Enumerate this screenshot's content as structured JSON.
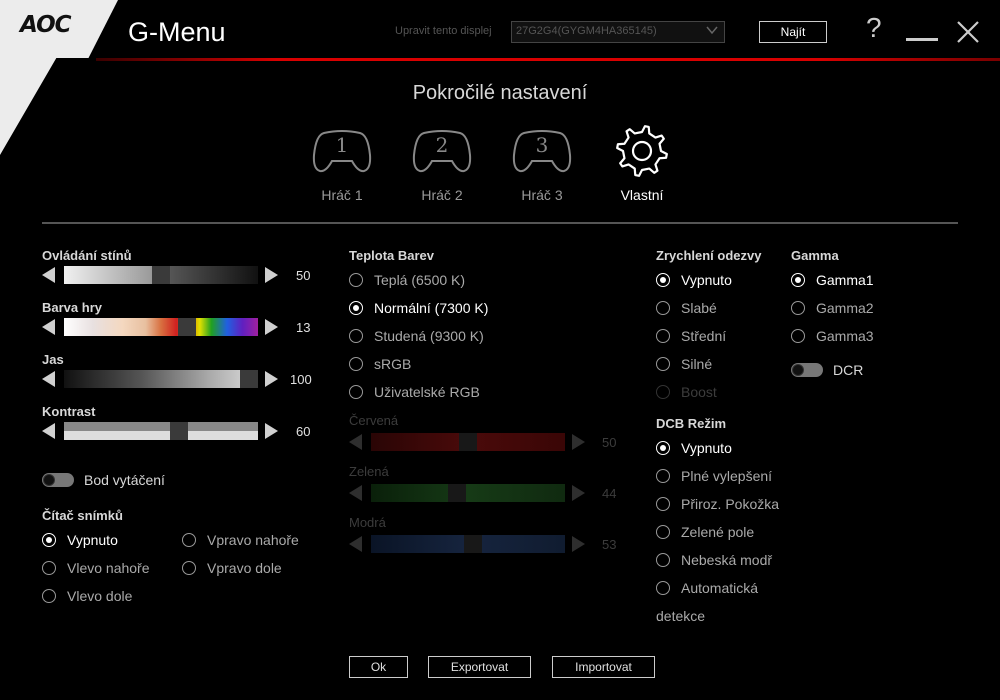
{
  "header": {
    "logo": "AOC",
    "title": "G-Menu",
    "display_label": "Upravit tento displej",
    "display_value": "27G2G4(GYGM4HA365145)",
    "find_label": "Najít",
    "help_symbol": "?"
  },
  "section_title": "Pokročilé nastavení",
  "profiles": [
    {
      "label": "Hráč 1",
      "number": "1"
    },
    {
      "label": "Hráč 2",
      "number": "2"
    },
    {
      "label": "Hráč 3",
      "number": "3"
    },
    {
      "label": "Vlastní",
      "active": true
    }
  ],
  "left": {
    "shadow_control": {
      "label": "Ovládání stínů",
      "value": "50",
      "fraction": 0.5
    },
    "game_color": {
      "label": "Barva hry",
      "value": "13",
      "fraction": 0.65
    },
    "brightness": {
      "label": "Jas",
      "value": "100",
      "fraction": 1.0
    },
    "contrast": {
      "label": "Kontrast",
      "value": "60",
      "fraction": 0.6
    },
    "dial_point": {
      "label": "Bod vytáčení"
    },
    "frame_counter": {
      "label": "Čítač snímků",
      "options": [
        "Vypnuto",
        "Vpravo nahoře",
        "Vlevo nahoře",
        "Vpravo dole",
        "Vlevo dole"
      ],
      "selected": "Vypnuto"
    }
  },
  "color_temp": {
    "label": "Teplota Barev",
    "options": [
      "Teplá (6500 K)",
      "Normální (7300 K)",
      "Studená (9300 K)",
      "sRGB",
      "Uživatelské RGB"
    ],
    "selected": "Normální (7300 K)",
    "red": {
      "label": "Červená",
      "value": "50",
      "fraction": 0.5
    },
    "green": {
      "label": "Zelená",
      "value": "44",
      "fraction": 0.44
    },
    "blue": {
      "label": "Modrá",
      "value": "53",
      "fraction": 0.53
    }
  },
  "overdrive": {
    "label": "Zrychlení odezvy",
    "options": [
      "Vypnuto",
      "Slabé",
      "Střední",
      "Silné",
      "Boost"
    ],
    "selected": "Vypnuto"
  },
  "gamma": {
    "label": "Gamma",
    "options": [
      "Gamma1",
      "Gamma2",
      "Gamma3"
    ],
    "selected": "Gamma1",
    "dcr_label": "DCR"
  },
  "dcb": {
    "label": "DCB Režim",
    "options": [
      "Vypnuto",
      "Plné vylepšení",
      "Přiroz. Pokožka",
      "Zelené pole",
      "Nebeská modř",
      "Automatická"
    ],
    "auto_wrap": "detekce",
    "selected": "Vypnuto"
  },
  "buttons": {
    "ok": "Ok",
    "export": "Exportovat",
    "import": "Importovat"
  },
  "colors": {
    "accent": "#d80000",
    "background": "#000000"
  }
}
